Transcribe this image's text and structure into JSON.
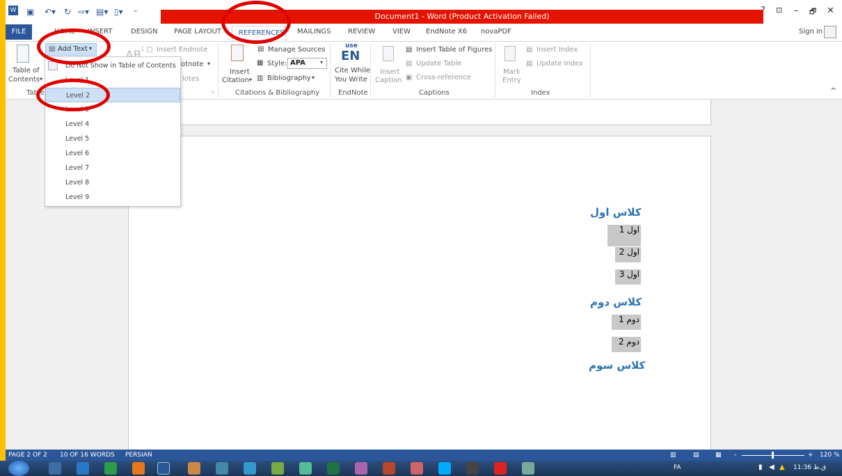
{
  "titlebar": {
    "title": "Document1 - Word (Product Activation Failed)",
    "help": "?",
    "minimize": "–",
    "restore": "🗗",
    "close": "✕",
    "sign_in": "Sign in"
  },
  "tabs": {
    "file": "FILE",
    "home": "HOME",
    "insert": "INSERT",
    "design": "DESIGN",
    "page_layout": "PAGE LAYOUT",
    "references": "REFERENCES",
    "mailings": "MAILINGS",
    "review": "REVIEW",
    "view": "VIEW",
    "endnote": "EndNote X6",
    "novapdf": "novaPDF"
  },
  "ribbon": {
    "toc_l1": "Table of",
    "toc_l2": "Contents",
    "toc_arrow": "▾",
    "add_text": "Add Text",
    "add_text_arrow": "▾",
    "ab_super": "AB",
    "superscript_1": "1",
    "insert_endnote": "Insert Endnote",
    "footnote_partial": "otnote",
    "footnote_arrow": "▾",
    "notes_partial": "lotes",
    "footnotes_launcher": "↘",
    "insert_citation_l1": "Insert",
    "insert_citation_l2": "Citation",
    "citation_arrow": "▾",
    "manage_sources": "Manage Sources",
    "style_label": "Style:",
    "style_value": "APA",
    "style_arrow": "▾",
    "bibliography": "Bibliography",
    "bib_arrow": "▾",
    "use_text": "use",
    "en_text": "EN",
    "cite_while_l1": "Cite While",
    "cite_while_l2": "You Write",
    "insert_caption_l1": "Insert",
    "insert_caption_l2": "Caption",
    "insert_table_of_figures": "Insert Table of Figures",
    "update_table": "Update Table",
    "cross_reference": "Cross-reference",
    "mark_entry_l1": "Mark",
    "mark_entry_l2": "Entry",
    "insert_index": "Insert Index",
    "update_index": "Update Index",
    "collapse": "^",
    "groups": {
      "toc_partial": "Table",
      "citations": "Citations & Bibliography",
      "endnote": "EndNote",
      "captions": "Captions",
      "index": "Index"
    }
  },
  "dropdown": {
    "item_dont_show": "Do Not Show in Table of Contents",
    "items": [
      "Level 1",
      "Level 2",
      "Level 3",
      "Level 4",
      "Level 5",
      "Level 6",
      "Level 7",
      "Level 8",
      "Level 9"
    ],
    "selected": "Level 2"
  },
  "document": {
    "heading1": "کلاس اول",
    "items1": [
      "اول 1",
      "اول 2",
      "اول 3"
    ],
    "heading2": "کلاس دوم",
    "items2": [
      "دوم 1",
      "دوم 2"
    ],
    "heading3": "کلاس سوم"
  },
  "statusbar": {
    "page": "PAGE 2 OF 2",
    "words": "10 OF 16 WORDS",
    "language": "PERSIAN",
    "zoom_minus": "-",
    "zoom_plus": "+",
    "zoom": "120 %"
  },
  "taskbar": {
    "lang": "FA",
    "time": "11:36 ق.ظ"
  },
  "colors": {
    "word_blue": "#2B579A",
    "title_red": "#E51400",
    "heading_blue": "#2E74B5",
    "annotation_red": "#E00000",
    "frame_yellow": "#FFC000"
  }
}
